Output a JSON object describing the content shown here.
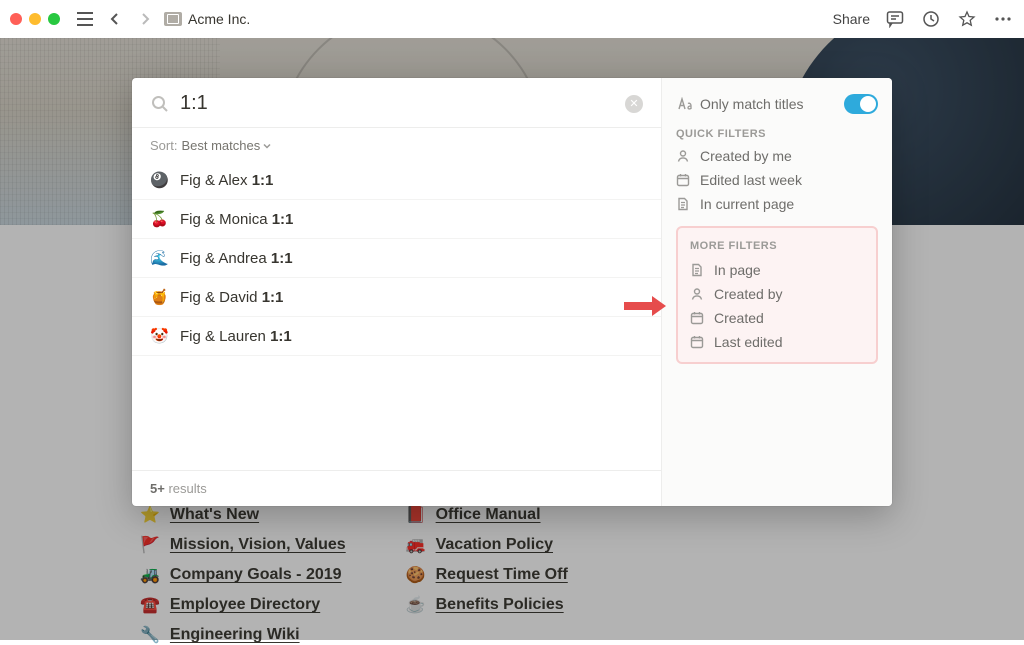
{
  "topbar": {
    "breadcrumb": "Acme Inc.",
    "share": "Share"
  },
  "search": {
    "value": "1:1",
    "sort_label": "Sort:",
    "sort_value": "Best matches",
    "results": [
      {
        "emoji": "🎱",
        "title": "Fig & Alex",
        "suffix": "1:1"
      },
      {
        "emoji": "🍒",
        "title": "Fig & Monica",
        "suffix": "1:1"
      },
      {
        "emoji": "🌊",
        "title": "Fig & Andrea",
        "suffix": "1:1"
      },
      {
        "emoji": "🍯",
        "title": "Fig & David",
        "suffix": "1:1"
      },
      {
        "emoji": "🤡",
        "title": "Fig & Lauren",
        "suffix": "1:1"
      }
    ],
    "footer_count": "5+",
    "footer_word": " results"
  },
  "filters": {
    "only_titles": "Only match titles",
    "quick_heading": "QUICK FILTERS",
    "quick": [
      {
        "label": "Created by me",
        "icon": "person"
      },
      {
        "label": "Edited last week",
        "icon": "calendar"
      },
      {
        "label": "In current page",
        "icon": "page"
      }
    ],
    "more_heading": "MORE FILTERS",
    "more": [
      {
        "label": "In page",
        "icon": "page"
      },
      {
        "label": "Created by",
        "icon": "person"
      },
      {
        "label": "Created",
        "icon": "calendar"
      },
      {
        "label": "Last edited",
        "icon": "calendar"
      }
    ]
  },
  "bg_links": {
    "left": [
      {
        "emoji": "⭐",
        "text": "What's New"
      },
      {
        "emoji": "🚩",
        "text": "Mission, Vision, Values"
      },
      {
        "emoji": "🚜",
        "text": "Company Goals - 2019"
      },
      {
        "emoji": "☎️",
        "text": "Employee Directory"
      },
      {
        "emoji": "🔧",
        "text": "Engineering Wiki"
      }
    ],
    "right": [
      {
        "emoji": "📕",
        "text": "Office Manual"
      },
      {
        "emoji": "🚒",
        "text": "Vacation Policy"
      },
      {
        "emoji": "🍪",
        "text": "Request Time Off"
      },
      {
        "emoji": "☕",
        "text": "Benefits Policies"
      }
    ]
  }
}
